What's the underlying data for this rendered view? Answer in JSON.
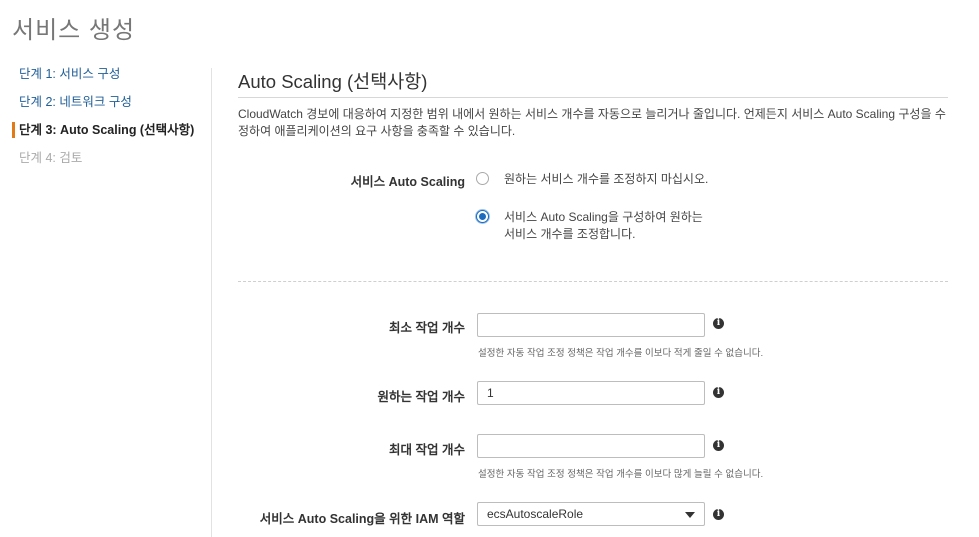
{
  "page": {
    "title": "서비스 생성"
  },
  "steps": [
    {
      "label": "단계 1: 서비스 구성",
      "state": "link"
    },
    {
      "label": "단계 2: 네트워크 구성",
      "state": "link"
    },
    {
      "label": "단계 3: Auto Scaling (선택사항)",
      "state": "active"
    },
    {
      "label": "단계 4: 검토",
      "state": "disabled"
    }
  ],
  "section": {
    "title": "Auto Scaling (선택사항)",
    "description": "CloudWatch 경보에 대응하여 지정한 범위 내에서 원하는 서비스 개수를 자동으로 늘리거나 줄입니다. 언제든지 서비스 Auto Scaling 구성을 수정하여 애플리케이션의 요구 사항을 충족할 수 있습니다."
  },
  "auto_scaling": {
    "label": "서비스 Auto Scaling",
    "options": [
      {
        "label": "원하는 서비스 개수를 조정하지 마십시오.",
        "selected": false
      },
      {
        "label": "서비스 Auto Scaling을 구성하여 원하는 서비스 개수를 조정합니다.",
        "selected": true
      }
    ]
  },
  "fields": {
    "min_tasks": {
      "label": "최소 작업 개수",
      "value": "",
      "help": "설정한 자동 작업 조정 정책은 작업 개수를 이보다 적게 줄일 수 없습니다."
    },
    "desired_tasks": {
      "label": "원하는 작업 개수",
      "value": "1"
    },
    "max_tasks": {
      "label": "최대 작업 개수",
      "value": "",
      "help": "설정한 자동 작업 조정 정책은 작업 개수를 이보다 많게 늘릴 수 없습니다."
    },
    "iam_role": {
      "label": "서비스 Auto Scaling을 위한 IAM 역할",
      "value": "ecsAutoscaleRole"
    }
  },
  "icons": {
    "info": "info-icon",
    "dropdown": "chevron-down-icon"
  },
  "colors": {
    "link": "#1f5e97",
    "active_marker": "#e07b17",
    "radio_selected": "#1c6bbf"
  }
}
